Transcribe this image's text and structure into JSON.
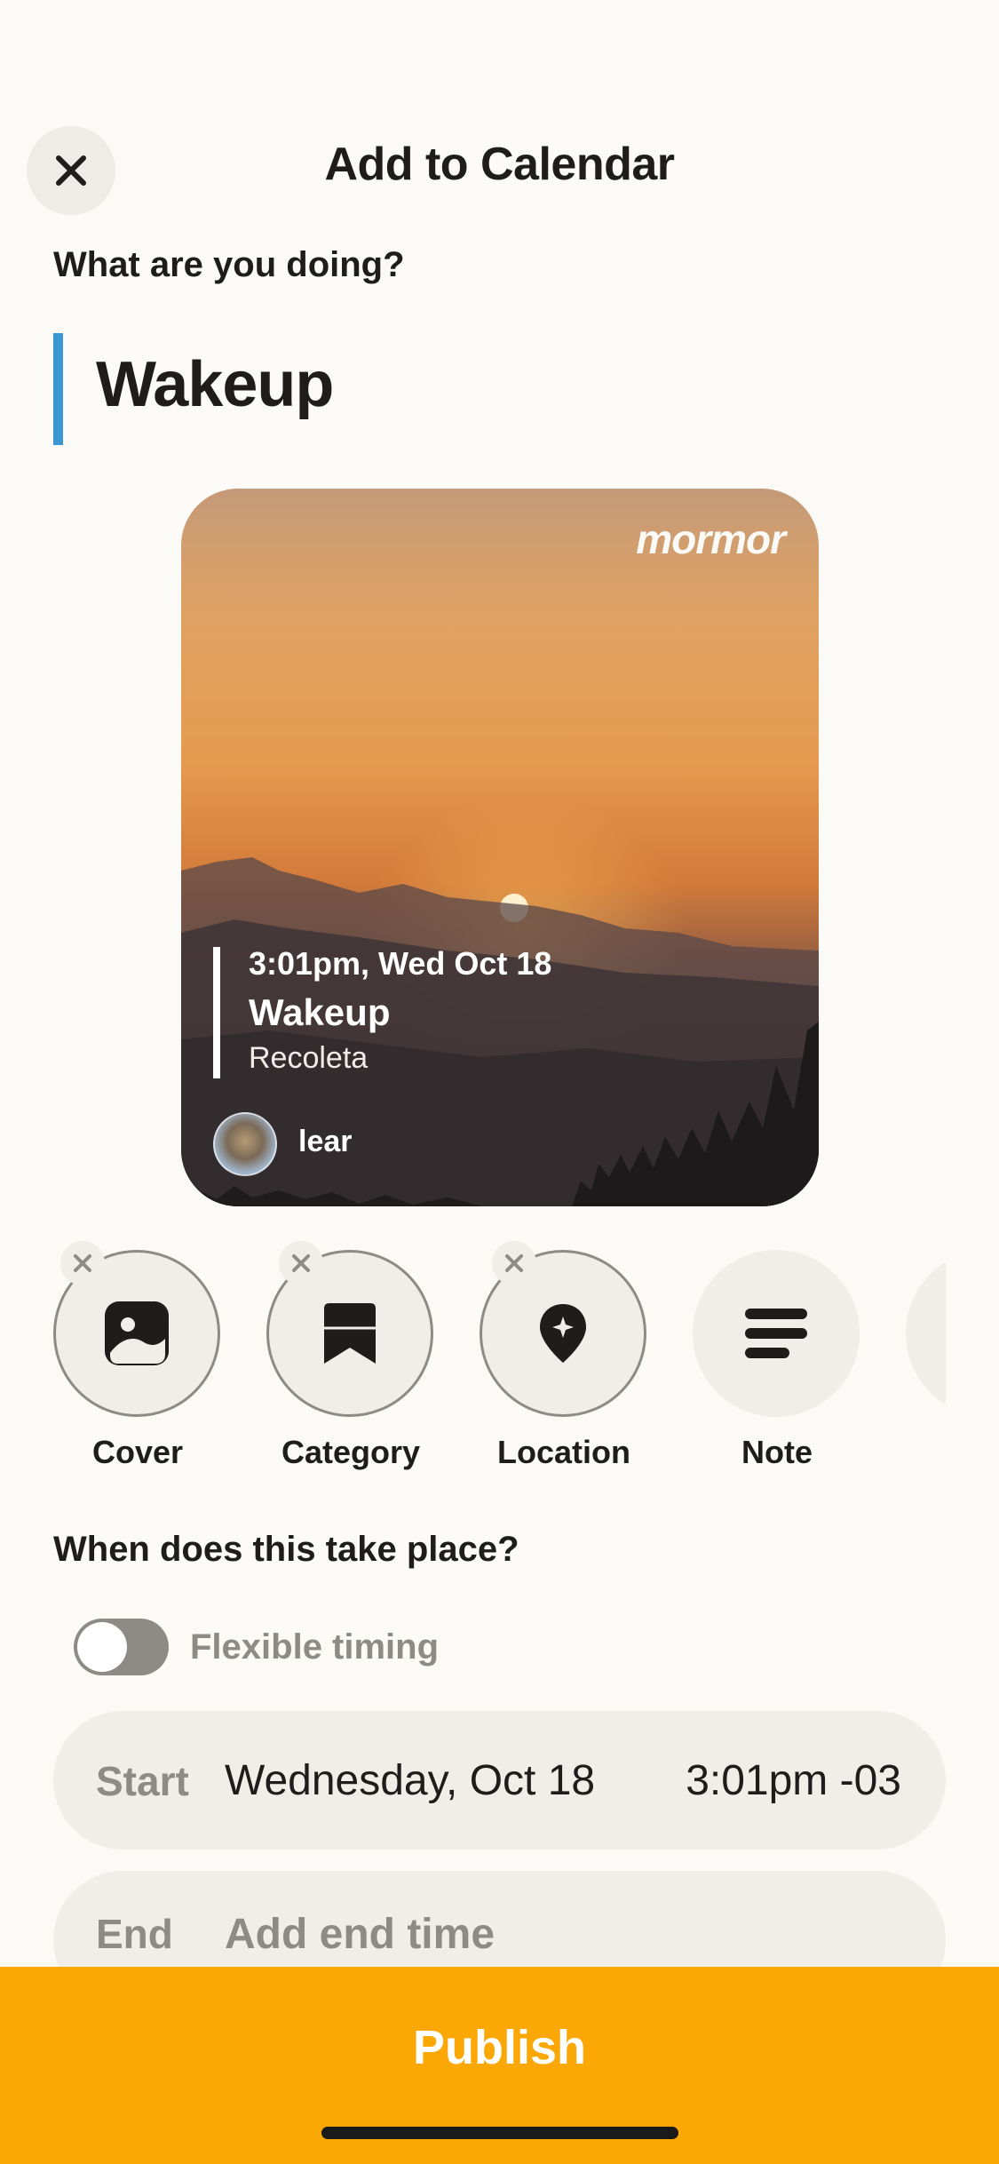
{
  "header": {
    "title": "Add to Calendar",
    "close_icon": "close-icon"
  },
  "prompt": "What are you doing?",
  "activity": {
    "text": "Wakeup",
    "accent_color": "#3A97D1"
  },
  "preview": {
    "brand": "mormor",
    "time": "3:01pm, Wed Oct 18",
    "event": "Wakeup",
    "location": "Recoleta",
    "user": "lear"
  },
  "actions": [
    {
      "label": "Cover",
      "icon": "image-icon",
      "removable": true
    },
    {
      "label": "Category",
      "icon": "bookmark-icon",
      "removable": true
    },
    {
      "label": "Location",
      "icon": "location-pin-icon",
      "removable": true
    },
    {
      "label": "Note",
      "icon": "lines-icon",
      "removable": false
    }
  ],
  "when": {
    "title": "When does this take place?",
    "flexible_label": "Flexible timing",
    "flexible_enabled": false,
    "start": {
      "label": "Start",
      "date": "Wednesday, Oct 18",
      "time": "3:01pm -03"
    },
    "end": {
      "label": "End",
      "placeholder": "Add end time"
    }
  },
  "publish": {
    "label": "Publish",
    "color": "#FBA705"
  }
}
